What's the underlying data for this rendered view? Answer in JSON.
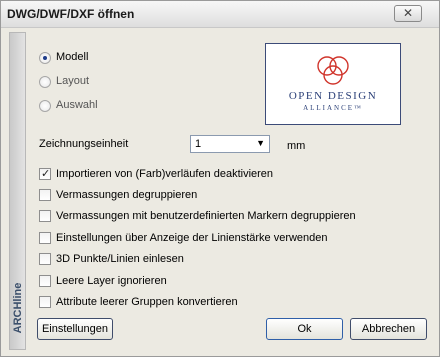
{
  "window": {
    "title": "DWG/DWF/DXF öffnen",
    "close_glyph": "✕"
  },
  "sidebar": {
    "brand": "ARCHline"
  },
  "view_mode": {
    "options": [
      {
        "label": "Modell",
        "selected": true
      },
      {
        "label": "Layout",
        "selected": false
      },
      {
        "label": "Auswahl",
        "selected": false
      }
    ]
  },
  "logo": {
    "line1": "OPEN DESIGN",
    "line2": "ALLIANCE™",
    "colors": [
      "#d0352c",
      "#2a3f77"
    ]
  },
  "units": {
    "label": "Zeichnungseinheit",
    "value": "1",
    "unit": "mm"
  },
  "options": [
    {
      "label": "Importieren von (Farb)verläufen deaktivieren",
      "checked": true
    },
    {
      "label": "Vermassungen degruppieren",
      "checked": false
    },
    {
      "label": "Vermassungen mit benutzerdefinierten Markern degruppieren",
      "checked": false
    },
    {
      "label": "Einstellungen über Anzeige der Linienstärke verwenden",
      "checked": false
    },
    {
      "label": "3D Punkte/Linien einlesen",
      "checked": false
    },
    {
      "label": "Leere Layer ignorieren",
      "checked": false
    },
    {
      "label": "Attribute leerer Gruppen konvertieren",
      "checked": false
    }
  ],
  "buttons": {
    "settings": "Einstellungen",
    "ok": "Ok",
    "cancel": "Abbrechen"
  }
}
